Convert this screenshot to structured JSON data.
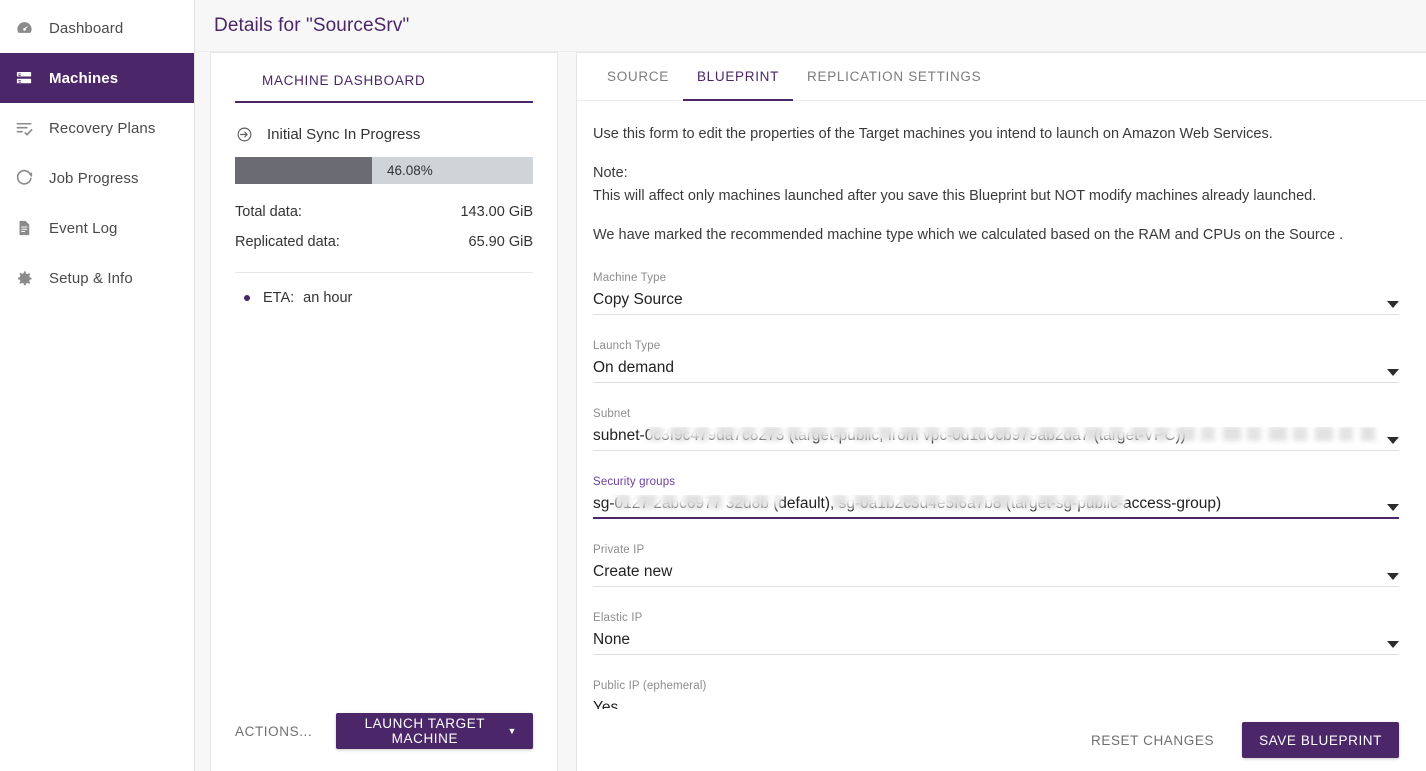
{
  "sidebar": {
    "items": [
      {
        "label": "Dashboard",
        "icon": "gauge-icon",
        "active": false
      },
      {
        "label": "Machines",
        "icon": "server-icon",
        "active": true
      },
      {
        "label": "Recovery Plans",
        "icon": "list-check-icon",
        "active": false
      },
      {
        "label": "Job Progress",
        "icon": "spinner-icon",
        "active": false
      },
      {
        "label": "Event Log",
        "icon": "document-icon",
        "active": false
      },
      {
        "label": "Setup & Info",
        "icon": "gear-icon",
        "active": false
      }
    ]
  },
  "header": {
    "title": "Details for \"SourceSrv\""
  },
  "machine_dashboard": {
    "tab_label": "MACHINE DASHBOARD",
    "status_icon": "sync-in-progress-icon",
    "status_text": "Initial Sync In Progress",
    "progress_percent_label": "46.08%",
    "progress_percent_value": 46.08,
    "stats": [
      {
        "label": "Total data:",
        "value": "143.00 GiB"
      },
      {
        "label": "Replicated data:",
        "value": "65.90 GiB"
      }
    ],
    "eta_label": "ETA:",
    "eta_value": "an hour",
    "actions_label": "ACTIONS...",
    "launch_button_label": "LAUNCH TARGET MACHINE"
  },
  "details": {
    "tabs": [
      {
        "label": "SOURCE",
        "active": false
      },
      {
        "label": "BLUEPRINT",
        "active": true
      },
      {
        "label": "REPLICATION SETTINGS",
        "active": false
      }
    ],
    "intro": {
      "line1": "Use this form to edit the properties of the Target machines you intend to launch on Amazon Web Services.",
      "note_title": "Note:",
      "note_body": "This will affect only machines launched after you save this Blueprint but NOT modify machines already launched.",
      "line3": "We have marked the recommended machine type which we calculated based on the RAM and CPUs on the Source ."
    },
    "fields": [
      {
        "label": "Machine Type",
        "value": "Copy Source",
        "focused": false,
        "redacted": false
      },
      {
        "label": "Launch Type",
        "value": "On demand",
        "focused": false,
        "redacted": false
      },
      {
        "label": "Subnet",
        "value": "subnet-0c3f9c479da7c8273 (target-public, from vpc-0d1d0cb979ab2da7 (target-VPC))",
        "focused": false,
        "redacted": true
      },
      {
        "label": "Security groups",
        "value": "sg-0127 2abc6977 32d8b (default), sg-0a1b2c3d4e5f6a7b8 (target-sg-public-access-group)",
        "focused": true,
        "redacted": true
      },
      {
        "label": "Private IP",
        "value": "Create new",
        "focused": false,
        "redacted": false
      },
      {
        "label": "Elastic IP",
        "value": "None",
        "focused": false,
        "redacted": false
      },
      {
        "label": "Public IP (ephemeral)",
        "value": "Yes",
        "focused": false,
        "redacted": false
      }
    ],
    "reset_label": "RESET CHANGES",
    "save_label": "SAVE BLUEPRINT"
  },
  "colors": {
    "brand_purple": "#4b2668",
    "progress_fill": "#6b6b73",
    "progress_track": "#cfd4d8",
    "page_bg": "#f7f7f7"
  }
}
